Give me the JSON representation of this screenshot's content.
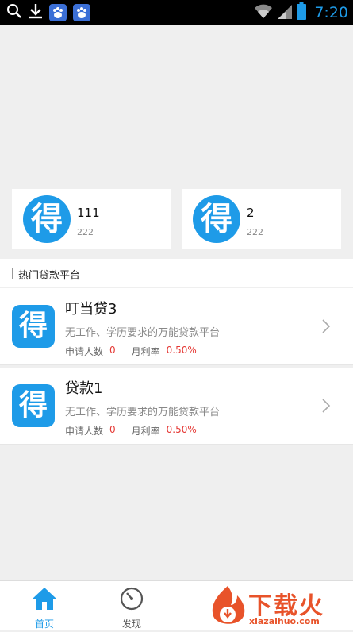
{
  "status_bar": {
    "time": "7:20",
    "icons": [
      "search-icon",
      "download-icon",
      "baidu-icon",
      "baidu-icon",
      "wifi-icon",
      "signal-icon",
      "battery-icon"
    ]
  },
  "colors": {
    "brand": "#1e9be8",
    "accent_red": "#e53935",
    "logo_dot": "#f5a623",
    "watermark": "#e8532a"
  },
  "featured": [
    {
      "logo_char": "得",
      "title": "111",
      "subtitle": "222"
    },
    {
      "logo_char": "得",
      "title": "2",
      "subtitle": "222"
    }
  ],
  "section": {
    "title": "热门贷款平台"
  },
  "loans": [
    {
      "logo_char": "得",
      "name": "叮当贷3",
      "description": "无工作、学历要求的万能贷款平台",
      "applicants_label": "申请人数",
      "applicants_value": "0",
      "rate_label": "月利率",
      "rate_value": "0.50%"
    },
    {
      "logo_char": "得",
      "name": "贷款1",
      "description": "无工作、学历要求的万能贷款平台",
      "applicants_label": "申请人数",
      "applicants_value": "0",
      "rate_label": "月利率",
      "rate_value": "0.50%"
    }
  ],
  "tabbar": {
    "home_label": "首页",
    "discover_label": "发现"
  },
  "watermark": {
    "text": "下载火",
    "url": "xiazaihuo.com"
  }
}
